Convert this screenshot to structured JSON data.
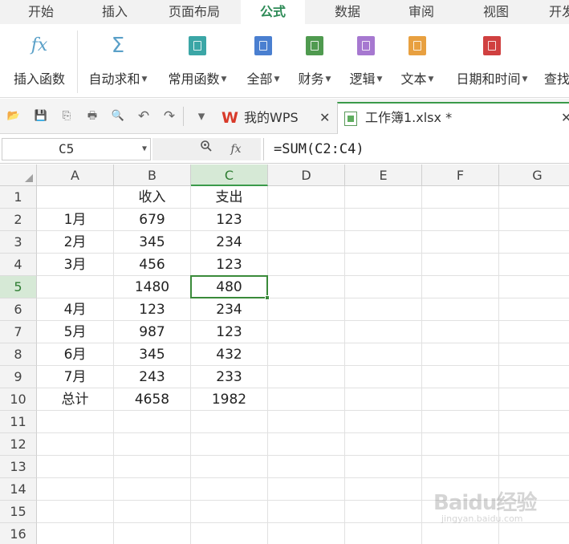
{
  "menu": {
    "tabs": [
      "开始",
      "插入",
      "页面布局",
      "公式",
      "数据",
      "审阅",
      "视图",
      "开发"
    ],
    "active_index": 3
  },
  "ribbon": {
    "buttons": [
      {
        "label": "插入函数",
        "icon": "function-fx-icon",
        "has_caret": false
      },
      {
        "label": "自动求和",
        "icon": "sigma-icon",
        "has_caret": true
      },
      {
        "label": "常用函数",
        "icon": "star-book-icon",
        "has_caret": true,
        "color": "#3ba6a6"
      },
      {
        "label": "全部",
        "icon": "list-book-icon",
        "has_caret": true,
        "color": "#4a7fd0"
      },
      {
        "label": "财务",
        "icon": "finance-book-icon",
        "has_caret": true,
        "color": "#4f9a4f"
      },
      {
        "label": "逻辑",
        "icon": "question-book-icon",
        "has_caret": true,
        "color": "#a678d0"
      },
      {
        "label": "文本",
        "icon": "text-book-icon",
        "has_caret": true,
        "color": "#e8a040"
      },
      {
        "label": "日期和时间",
        "icon": "clock-book-icon",
        "has_caret": true,
        "color": "#d04040"
      },
      {
        "label": "查找",
        "icon": "",
        "has_caret": false
      }
    ]
  },
  "quick_access": {
    "icons": [
      "open-folder-icon",
      "save-icon",
      "export-icon",
      "print-icon",
      "print-preview-icon",
      "undo-icon",
      "redo-icon",
      "customize-dropdown-icon"
    ]
  },
  "doc_tabs": [
    {
      "label": "我的WPS",
      "icon": "wps-logo-icon",
      "active": false
    },
    {
      "label": "工作簿1.xlsx *",
      "icon": "spreadsheet-file-icon",
      "active": true
    }
  ],
  "formula_bar": {
    "name_box": "C5",
    "formula": "=SUM(C2:C4)",
    "zoom_icon": "zoom-icon",
    "fx_label": "fx"
  },
  "sheet": {
    "columns": [
      "A",
      "B",
      "C",
      "D",
      "E",
      "F",
      "G"
    ],
    "active_column": "C",
    "rows": [
      {
        "n": "1",
        "cells": [
          "",
          "收入",
          "支出",
          "",
          "",
          "",
          ""
        ]
      },
      {
        "n": "2",
        "cells": [
          "1月",
          "679",
          "123",
          "",
          "",
          "",
          ""
        ]
      },
      {
        "n": "3",
        "cells": [
          "2月",
          "345",
          "234",
          "",
          "",
          "",
          ""
        ]
      },
      {
        "n": "4",
        "cells": [
          "3月",
          "456",
          "123",
          "",
          "",
          "",
          ""
        ]
      },
      {
        "n": "5",
        "cells": [
          "",
          "1480",
          "480",
          "",
          "",
          "",
          ""
        ]
      },
      {
        "n": "6",
        "cells": [
          "4月",
          "123",
          "234",
          "",
          "",
          "",
          ""
        ]
      },
      {
        "n": "7",
        "cells": [
          "5月",
          "987",
          "123",
          "",
          "",
          "",
          ""
        ]
      },
      {
        "n": "8",
        "cells": [
          "6月",
          "345",
          "432",
          "",
          "",
          "",
          ""
        ]
      },
      {
        "n": "9",
        "cells": [
          "7月",
          "243",
          "233",
          "",
          "",
          "",
          ""
        ]
      },
      {
        "n": "10",
        "cells": [
          "总计",
          "4658",
          "1982",
          "",
          "",
          "",
          ""
        ]
      },
      {
        "n": "11",
        "cells": [
          "",
          "",
          "",
          "",
          "",
          "",
          ""
        ]
      },
      {
        "n": "12",
        "cells": [
          "",
          "",
          "",
          "",
          "",
          "",
          ""
        ]
      },
      {
        "n": "13",
        "cells": [
          "",
          "",
          "",
          "",
          "",
          "",
          ""
        ]
      },
      {
        "n": "14",
        "cells": [
          "",
          "",
          "",
          "",
          "",
          "",
          ""
        ]
      },
      {
        "n": "15",
        "cells": [
          "",
          "",
          "",
          "",
          "",
          "",
          ""
        ]
      },
      {
        "n": "16",
        "cells": [
          "",
          "",
          "",
          "",
          "",
          "",
          ""
        ]
      }
    ],
    "active_row": "5"
  },
  "watermark": {
    "main": "Baidu经验",
    "sub": "jingyan.baidu.com"
  },
  "colors": {
    "accent_green": "#3a9a4a",
    "active_tab_text": "#2e8b57"
  }
}
